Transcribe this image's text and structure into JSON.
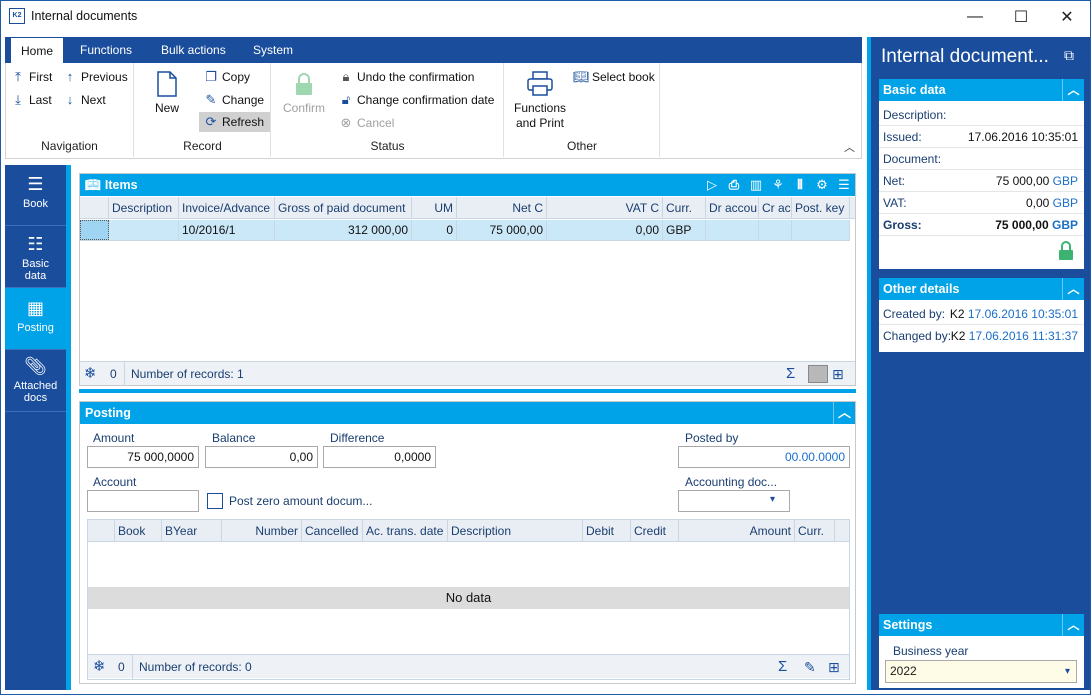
{
  "window": {
    "title": "Internal documents",
    "app_icon_text": "K2",
    "minimize": "—",
    "maximize": "☐",
    "close": "✕"
  },
  "ribbon": {
    "tabs": [
      "Home",
      "Functions",
      "Bulk actions",
      "System"
    ],
    "navigation": {
      "label": "Navigation",
      "first": "First",
      "last": "Last",
      "previous": "Previous",
      "next": "Next"
    },
    "record": {
      "label": "Record",
      "new": "New",
      "copy": "Copy",
      "change": "Change",
      "refresh": "Refresh"
    },
    "status": {
      "label": "Status",
      "confirm": "Confirm",
      "undo_confirmation": "Undo the confirmation",
      "change_confirmation_date": "Change confirmation date",
      "cancel": "Cancel"
    },
    "other": {
      "label": "Other",
      "functions_print_1": "Functions",
      "functions_print_2": "and Print",
      "select_book": "Select book"
    }
  },
  "leftnav": [
    {
      "label": "Book",
      "icon": "menu-icon"
    },
    {
      "label": "Basic data",
      "icon": "list-icon"
    },
    {
      "label": "Posting",
      "icon": "calculator-icon"
    },
    {
      "label": "Attached docs",
      "icon": "paperclip-icon"
    }
  ],
  "items": {
    "title": "Items",
    "columns": [
      "Description",
      "Invoice/Advance",
      "Gross of paid document",
      "UM",
      "Net C",
      "VAT C",
      "Curr.",
      "Dr accou",
      "Cr ac",
      "Post. key"
    ],
    "rows": [
      {
        "description": "",
        "invoice": "10/2016/1",
        "gross": "312 000,00",
        "um": "0",
        "net": "75 000,00",
        "vat": "0,00",
        "curr": "GBP",
        "dr": "",
        "cr": "",
        "post_key": ""
      }
    ],
    "footer_count": "0",
    "footer_records": "Number of records: 1"
  },
  "posting": {
    "title": "Posting",
    "amount_label": "Amount",
    "amount_value": "75 000,0000",
    "balance_label": "Balance",
    "balance_value": "0,00",
    "difference_label": "Difference",
    "difference_value": "0,0000",
    "posted_by_label": "Posted by",
    "posted_by_value": "00.00.0000",
    "account_label": "Account",
    "account_value": "",
    "post_zero_label": "Post zero amount docum...",
    "accounting_doc_label": "Accounting doc...",
    "accounting_doc_value": "",
    "columns": [
      "Book",
      "BYear",
      "Number",
      "Cancelled",
      "Ac. trans. date",
      "Description",
      "Debit",
      "Credit",
      "Amount",
      "Curr."
    ],
    "no_data": "No data",
    "footer_count": "0",
    "footer_records": "Number of records: 0"
  },
  "right": {
    "title": "Internal document...",
    "basic_data": {
      "label": "Basic data",
      "description_label": "Description:",
      "issued_label": "Issued:",
      "issued_value": "17.06.2016 10:35:01",
      "document_label": "Document:",
      "net_label": "Net:",
      "net_value": "75 000,00",
      "net_curr": "GBP",
      "vat_label": "VAT:",
      "vat_value": "0,00",
      "vat_curr": "GBP",
      "gross_label": "Gross:",
      "gross_value": "75 000,00",
      "gross_curr": "GBP"
    },
    "other_details": {
      "label": "Other details",
      "created_label": "Created by:",
      "created_user": "K2",
      "created_date": "17.06.2016 10:35:01",
      "changed_label": "Changed by:",
      "changed_user": "K2",
      "changed_date": "17.06.2016 11:31:37"
    },
    "settings": {
      "label": "Settings",
      "business_year_label": "Business year",
      "business_year_value": "2022"
    }
  },
  "colors": {
    "navy": "#1a4e9c",
    "accent": "#00a3e8",
    "lock_green": "#3cb371"
  }
}
